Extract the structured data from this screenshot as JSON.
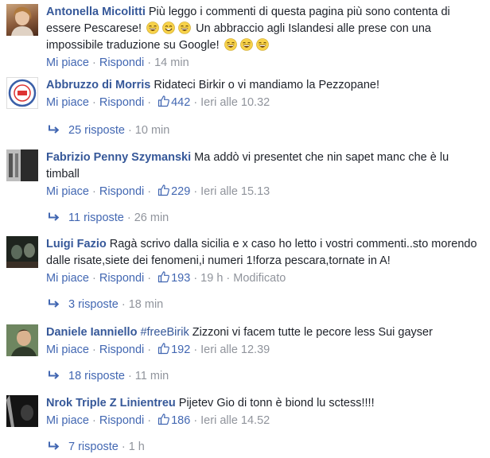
{
  "comments": [
    {
      "author": "Antonella Micolitti",
      "text_a": "Più leggo i commenti di questa pagina più sono contenta di essere Pescarese!",
      "text_b": "Un abbraccio agli Islandesi alle prese con una impossibile traduzione su Google!",
      "like_label": "Mi piace",
      "reply_label": "Rispondi",
      "time": "14 min",
      "avatar_icon": "user-photo-icon"
    },
    {
      "author": "Abbruzzo di Morris",
      "text": "Ridateci Birkir o vi mandiamo la Pezzopane!",
      "like_label": "Mi piace",
      "reply_label": "Rispondi",
      "likes": "442",
      "time": "Ieri alle 10.32",
      "replies": "25 risposte",
      "replies_time": "10 min",
      "avatar_icon": "badge-logo-icon"
    },
    {
      "author": "Fabrizio Penny Szymanski",
      "text": "Ma addò vi presentet che nin sapet manc che è lu timball",
      "like_label": "Mi piace",
      "reply_label": "Rispondi",
      "likes": "229",
      "time": "Ieri alle 15.13",
      "replies": "11 risposte",
      "replies_time": "26 min",
      "avatar_icon": "user-photo-icon"
    },
    {
      "author": "Luigi Fazio",
      "text": "Ragà scrivo dalla sicilia e x caso ho letto i vostri commenti..sto morendo dalle risate,siete dei fenomeni,i numeri 1!forza pescara,tornate in A!",
      "like_label": "Mi piace",
      "reply_label": "Rispondi",
      "likes": "193",
      "time": "19 h",
      "edited": "Modificato",
      "replies": "3 risposte",
      "replies_time": "18 min",
      "avatar_icon": "user-photo-icon"
    },
    {
      "author": "Daniele Ianniello",
      "hashtag": "#freeBirik",
      "text": "Zizzoni vi facem tutte le pecore less Sui gayser",
      "like_label": "Mi piace",
      "reply_label": "Rispondi",
      "likes": "192",
      "time": "Ieri alle 12.39",
      "replies": "18 risposte",
      "replies_time": "11 min",
      "avatar_icon": "user-photo-icon"
    },
    {
      "author": "Nrok Triple Z Linientreu",
      "text": "Pijetev Gio di tonn è biond lu sctess!!!!",
      "like_label": "Mi piace",
      "reply_label": "Rispondi",
      "likes": "186",
      "time": "Ieri alle 14.52",
      "replies": "7 risposte",
      "replies_time": "1 h",
      "avatar_icon": "user-photo-icon"
    }
  ],
  "separator": "·",
  "colors": {
    "link": "#4267b2",
    "author": "#365899",
    "meta": "#90949c",
    "text": "#1d2129"
  }
}
